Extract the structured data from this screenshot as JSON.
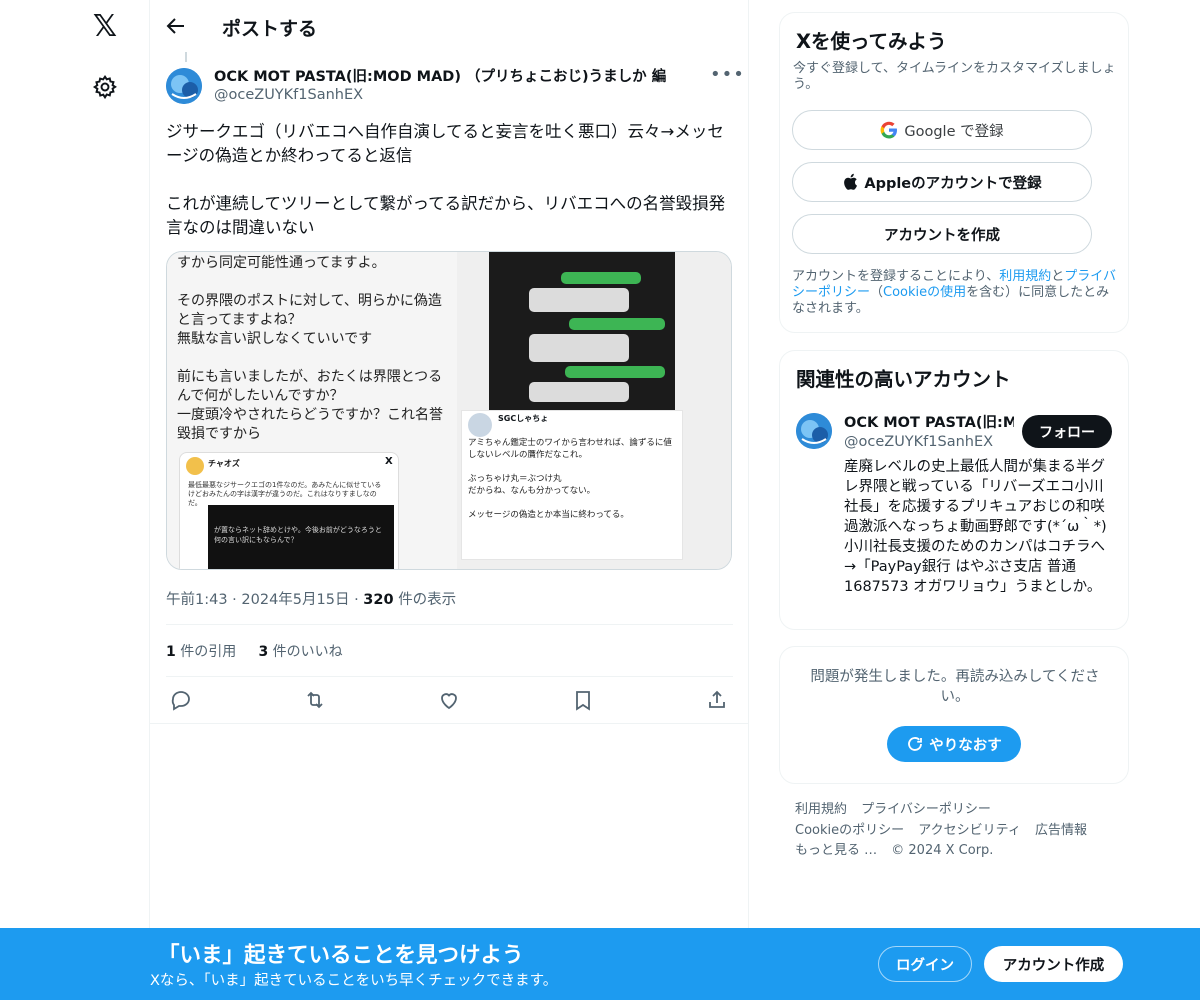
{
  "nav": {
    "logo": "𝕏"
  },
  "header": {
    "title": "ポストする"
  },
  "post": {
    "author_name": "OCK MOT PASTA(旧:MOD MAD) （プリちょこおじ)うましか 編",
    "author_handle": "@oceZUYKf1SanhEX",
    "text": "ジサークエゴ（リバエコへ自作自演してると妄言を吐く悪口）云々→メッセージの偽造とか終わってると返信\n\nこれが連続してツリーとして繋がってる訳だから、リバエコへの名誉毀損発言なのは間違いない",
    "time": "午前1:43",
    "date": "2024年5月15日",
    "views_count": "320",
    "views_label": "件の表示",
    "quotes_count": "1",
    "quotes_label": "件の引用",
    "likes_count": "3",
    "likes_label": "件のいいね"
  },
  "media": {
    "left_text": "すから同定可能性通ってますよ。\n\nその界隈のポストに対して、明らかに偽造と言ってますよね？\n無駄な言い訳しなくていいです\n\n前にも言いましたが、おたくは界隈とつるんで何がしたいんですか？\n一度頭冷やされたらどうですか？これ名誉毀損ですから",
    "embed_name": "チャオズ",
    "embed_text": "最低最悪なジサークエゴの1件なのだ。あみたんに似せているけどおみたんの字は漢字が違うのだ。これはなりすましなのだ。",
    "embed_dark_text": "が置ならネット辞めとけや。今後お前がどうなろうと何の言い訳にもならんで？",
    "card_name": "SGCしゃちょ",
    "card_text": "アミちゃん鑑定士のワイから言わせれば、論ずるに値しないレベルの贋作だなこれ。\n\nぶっちゃけ丸＝ぶつけ丸\nだからね、なんも分かってない。\n\nメッセージの偽造とか本当に終わってる。"
  },
  "signup": {
    "title": "Xを使ってみよう",
    "subtitle": "今すぐ登録して、タイムラインをカスタマイズしましょう。",
    "google_label": "Google で登録",
    "apple_label": "Appleのアカウントで登録",
    "create_label": "アカウントを作成",
    "legal_1": "アカウントを登録することにより、",
    "legal_terms": "利用規約",
    "legal_2": "と",
    "legal_privacy": "プライバシーポリシー",
    "legal_3": "（",
    "legal_cookie": "Cookieの使用",
    "legal_4": "を含む）に同意したとみなされます。"
  },
  "related": {
    "title": "関連性の高いアカウント",
    "name": "OCK MOT PASTA(旧:MOD MAD) （プリちょこおじ)うましか 編",
    "handle": "@oceZUYKf1SanhEX",
    "follow_label": "フォロー",
    "bio": "産廃レベルの史上最低人間が集まる半グレ界隈と戦っている「リバーズエコ小川社長」を応援するプリキュアおじの和咲過激派へなっちょ動画野郎です(*´ω｀*) 小川社長支援のためのカンパはコチラへ→「PayPay銀行 はやぶさ支店 普通 1687573 オガワリョウ」うまとしか。"
  },
  "error": {
    "text": "問題が発生しました。再読み込みしてください。",
    "retry_label": "やりなおす"
  },
  "footer": {
    "terms": "利用規約",
    "privacy": "プライバシーポリシー",
    "cookie": "Cookieのポリシー",
    "accessibility": "アクセシビリティ",
    "ads": "広告情報",
    "more": "もっと見る …",
    "copyright": "© 2024 X Corp."
  },
  "banner": {
    "title": "「いま」起きていることを見つけよう",
    "subtitle": "Xなら、「いま」起きていることをいち早くチェックできます。",
    "login_label": "ログイン",
    "create_label": "アカウント作成"
  },
  "colors": {
    "accent": "#1d9bf0",
    "text": "#0f1419",
    "muted": "#536471",
    "border": "#eff3f4"
  }
}
